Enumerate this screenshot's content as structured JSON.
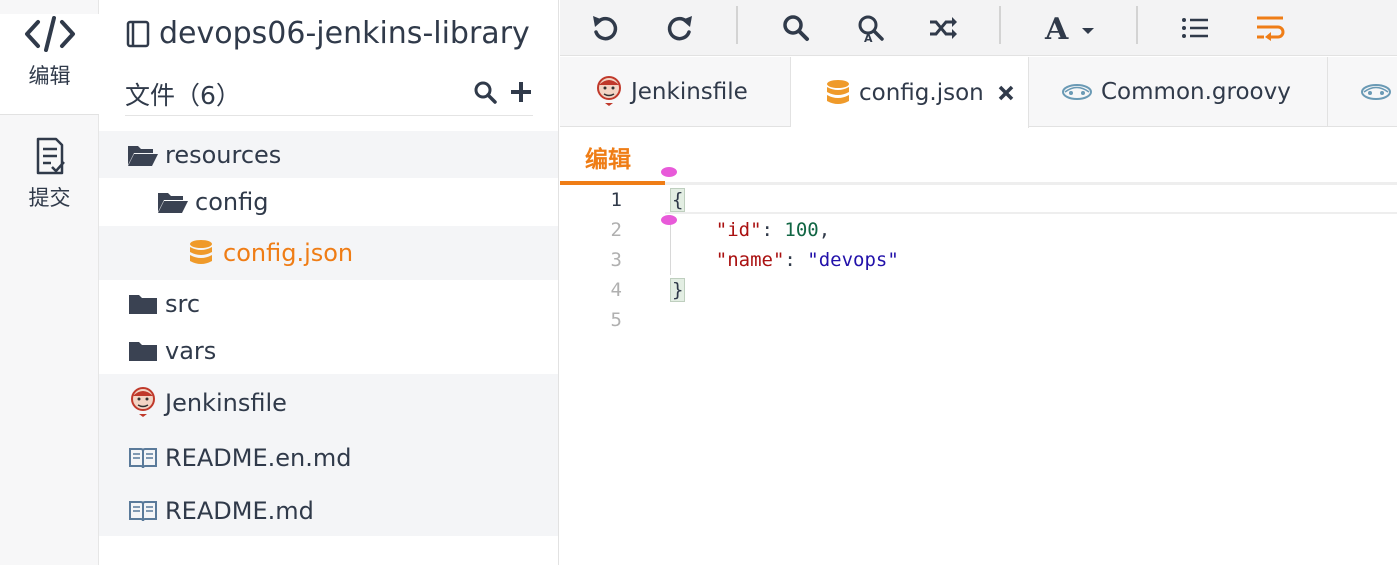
{
  "rail": {
    "edit_label": "编辑",
    "commit_label": "提交"
  },
  "tree": {
    "repo_name": "devops06-jenkins-library",
    "files_header": "文件（6）",
    "items": [
      {
        "label": "resources",
        "icon": "folder-open-icon"
      },
      {
        "label": "config",
        "icon": "folder-open-icon"
      },
      {
        "label": "config.json",
        "icon": "database-icon"
      },
      {
        "label": "src",
        "icon": "folder-icon"
      },
      {
        "label": "vars",
        "icon": "folder-icon"
      },
      {
        "label": "Jenkinsfile",
        "icon": "jenkins-icon"
      },
      {
        "label": "README.en.md",
        "icon": "book-icon"
      },
      {
        "label": "README.md",
        "icon": "book-icon"
      }
    ]
  },
  "tabs": [
    {
      "label": "Jenkinsfile",
      "icon": "jenkins-icon"
    },
    {
      "label": "config.json",
      "icon": "database-icon"
    },
    {
      "label": "Common.groovy",
      "icon": "groovy-icon"
    }
  ],
  "editor": {
    "mode_label": "编辑",
    "line_numbers": [
      "1",
      "2",
      "3",
      "4",
      "5"
    ]
  },
  "colors": {
    "accent": "#ef7d16",
    "text": "#303a4a"
  }
}
